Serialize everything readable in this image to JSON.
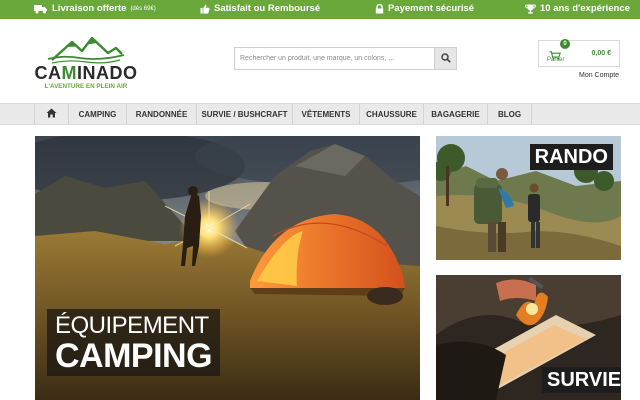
{
  "topbar": {
    "promo1": "Livraison offerte",
    "promo1_note": "(dès 69€)",
    "promo2": "Satisfait ou Remboursé",
    "promo3": "Payement sécurisé",
    "promo4": "10 ans d'expérience",
    "color": "#6aa83b"
  },
  "logo": {
    "brand_a": "CA",
    "brand_m": "M",
    "brand_b": "INADO",
    "tagline": "L'AVENTURE EN PLEIN AIR"
  },
  "search": {
    "placeholder": "Rechercher un produit, une marque, un coloris, ..."
  },
  "cart": {
    "count": "0",
    "label": "Panier",
    "total": "0,00 €"
  },
  "account": {
    "label": "Mon Compte"
  },
  "nav": {
    "items": [
      "CAMPING",
      "RANDONNÉE",
      "SURVIE / BUSHCRAFT",
      "VÊTEMENTS",
      "CHAUSSURE",
      "BAGAGERIE",
      "BLOG"
    ]
  },
  "hero": {
    "line1": "ÉQUIPEMENT",
    "line2": "CAMPING"
  },
  "tiles": {
    "rando": "RANDO",
    "survie": "SURVIE"
  },
  "colors": {
    "accent": "#6aa83b",
    "dark_green": "#3b8a2f",
    "nav_bg": "#e9e9e9"
  },
  "icons": [
    "truck-icon",
    "thumbs-up-icon",
    "lock-icon",
    "trophy-icon",
    "search-icon",
    "cart-icon",
    "home-icon"
  ]
}
